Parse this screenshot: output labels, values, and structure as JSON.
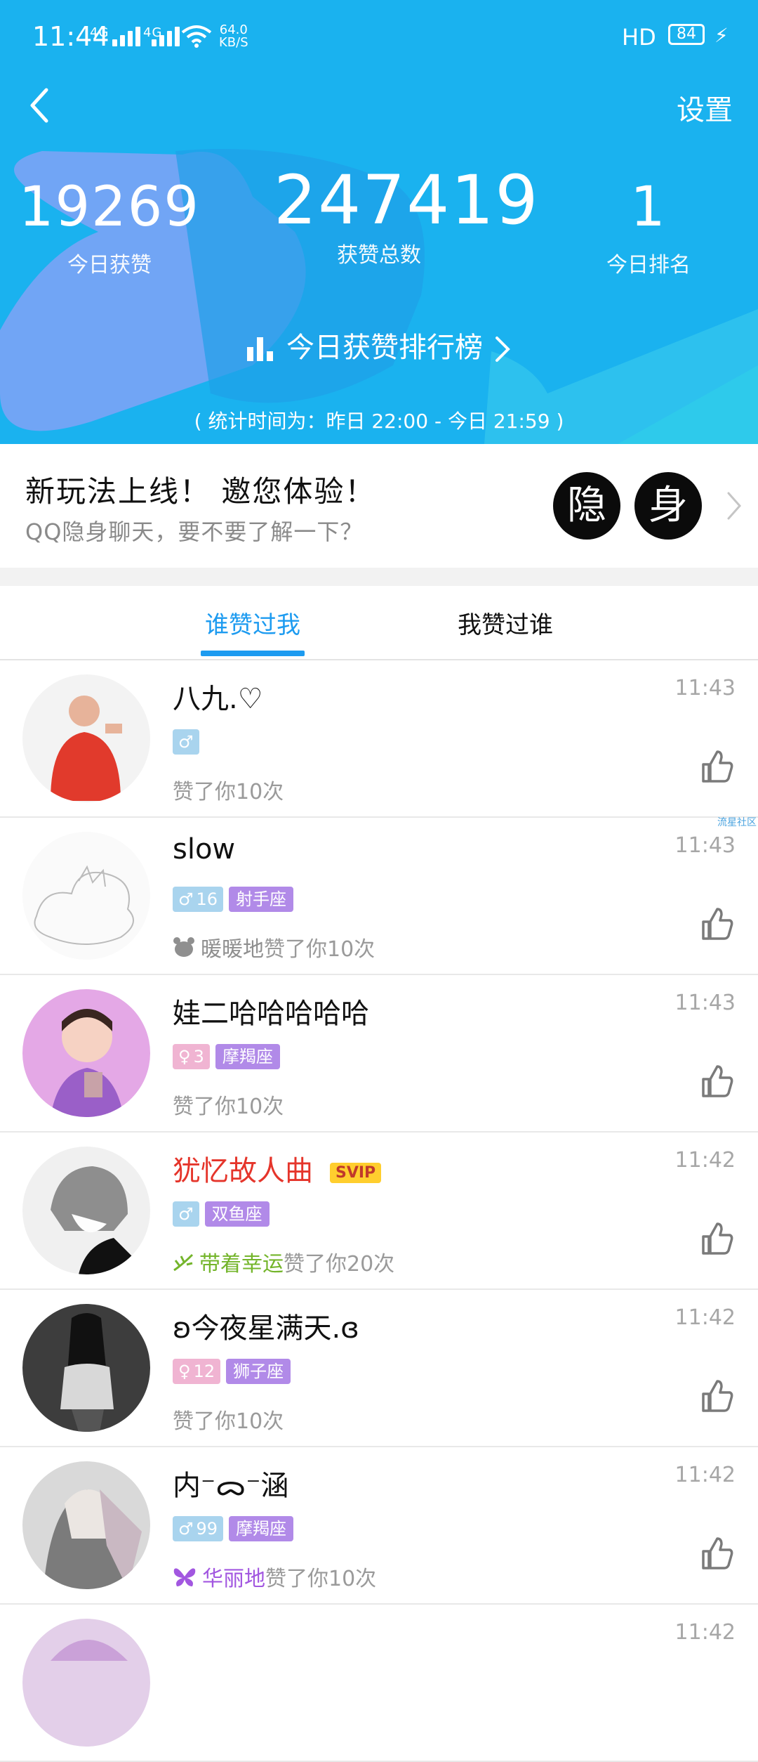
{
  "status_bar": {
    "time": "11:44",
    "signal1": "4G",
    "signal2": "4G",
    "net_speed_value": "64.0",
    "net_speed_unit": "KB/S",
    "hd": "HD",
    "battery": "84",
    "icons": [
      "signal-icon",
      "wifi-icon",
      "charging-icon"
    ]
  },
  "header": {
    "settings_label": "设置",
    "stats": [
      {
        "value": "19269",
        "label": "今日获赞"
      },
      {
        "value": "247419",
        "label": "获赞总数"
      },
      {
        "value": "1",
        "label": "今日排名"
      }
    ],
    "rank_link_label": "今日获赞排行榜",
    "period_text": "( 统计时间为：昨日 22:00 - 今日 21:59 )"
  },
  "promo": {
    "title": "新玩法上线！ 邀您体验！",
    "subtitle": "QQ隐身聊天，要不要了解一下？",
    "badge_1": "隐",
    "badge_2": "身"
  },
  "tabs": [
    {
      "label": "谁赞过我",
      "active": true
    },
    {
      "label": "我赞过谁",
      "active": false
    }
  ],
  "likes": [
    {
      "name": "八九.♡",
      "time": "11:43",
      "gender": "♂",
      "age": "",
      "constellation": "",
      "desc_prefix": "",
      "desc": "赞了你10次"
    },
    {
      "name": "slow",
      "time": "11:43",
      "gender": "♂",
      "age": "16",
      "constellation": "射手座",
      "desc_prefix": "暖暖地",
      "desc": "赞了你10次"
    },
    {
      "name": "娃二哈哈哈哈哈",
      "time": "11:43",
      "gender": "♀",
      "age": "3",
      "constellation": "摩羯座",
      "desc_prefix": "",
      "desc": "赞了你10次"
    },
    {
      "name": "犹忆故人曲",
      "badge": "SVIP",
      "time": "11:42",
      "gender": "♂",
      "age": "",
      "constellation": "双鱼座",
      "desc_prefix": "带着幸运",
      "desc": "赞了你20次"
    },
    {
      "name": "ʚ今夜星满天.ɞ",
      "time": "11:42",
      "gender": "♀",
      "age": "12",
      "constellation": "狮子座",
      "desc_prefix": "",
      "desc": "赞了你10次"
    },
    {
      "name": "内⁻ᯅ⁻涵",
      "time": "11:42",
      "gender": "♂",
      "age": "99",
      "constellation": "摩羯座",
      "desc_prefix": "华丽地",
      "desc": "赞了你10次"
    },
    {
      "name": "",
      "time": "11:42"
    }
  ],
  "watermark": "流星社区",
  "colors": {
    "header_bg": "#1ab2ef",
    "accent": "#1d9bf0",
    "svip_bg": "#ffce2e",
    "constellation_tag": "#b18ae8",
    "male_tag": "#a9d4ee",
    "female_tag": "#f0b4d2"
  }
}
